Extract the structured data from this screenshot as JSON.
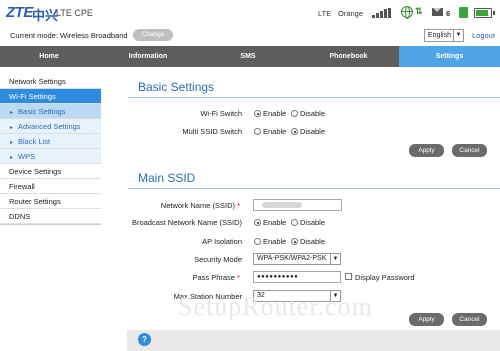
{
  "header": {
    "logo": "ZTE",
    "logo_cn": "中兴",
    "product": "LTE CPE",
    "network_type": "LTE",
    "operator": "Orange",
    "message_count": "6",
    "battery_level": 0.85
  },
  "modebar": {
    "mode_label": "Current mode: Wireless Broadband",
    "change_label": "Change",
    "language": "English",
    "logout_label": "Logout"
  },
  "nav": {
    "items": [
      "Home",
      "Information",
      "SMS",
      "Phonebook",
      "Settings"
    ],
    "active": "Settings"
  },
  "sidebar": {
    "items": [
      {
        "label": "Network Settings"
      },
      {
        "label": "Wi-Fi Settings"
      },
      {
        "label": "Basic Settings"
      },
      {
        "label": "Advanced Settings"
      },
      {
        "label": "Black List"
      },
      {
        "label": "WPS"
      },
      {
        "label": "Device Settings"
      },
      {
        "label": "Firewall"
      },
      {
        "label": "Router Settings"
      },
      {
        "label": "DDNS"
      }
    ]
  },
  "basic": {
    "title": "Basic Settings",
    "wifi_switch_label": "Wi-Fi Switch",
    "multi_ssid_label": "Multi SSID Switch",
    "enable": "Enable",
    "disable": "Disable",
    "apply": "Apply",
    "cancel": "Cancel"
  },
  "ssid": {
    "title": "Main SSID",
    "name_label": "Network Name (SSID)",
    "required": "*",
    "broadcast_label": "Broadcast Network Name (SSID)",
    "ap_isolation_label": "AP Isolation",
    "security_label": "Security Mode",
    "security_value": "WPA-PSK/WPA2-PSK",
    "pass_label": "Pass Phrase",
    "pass_value": "●●●●●●●●●●",
    "display_password": "Display Password",
    "max_station_label": "Max Station Number",
    "max_station_value": "32",
    "apply": "Apply",
    "cancel": "Cancel"
  },
  "watermark": "SetupRouter.com"
}
